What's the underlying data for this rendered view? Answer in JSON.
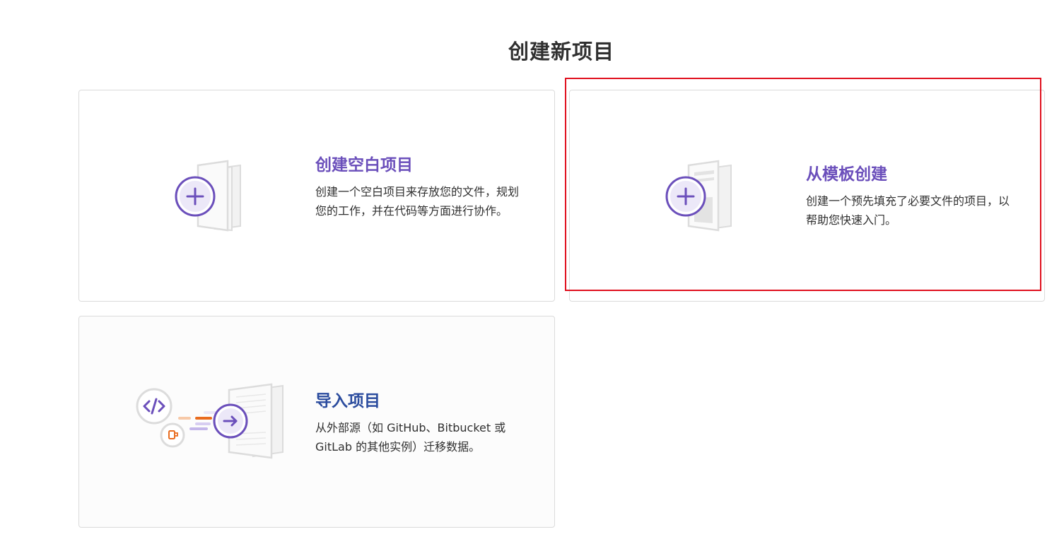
{
  "page": {
    "title": "创建新项目"
  },
  "cards": [
    {
      "id": "blank",
      "title": "创建空白项目",
      "description": "创建一个空白项目来存放您的文件，规划您的工作，并在代码等方面进行协作。",
      "icon": "plus-icon"
    },
    {
      "id": "template",
      "title": "从模板创建",
      "description": "创建一个预先填充了必要文件的项目，以帮助您快速入门。",
      "icon": "plus-icon"
    },
    {
      "id": "import",
      "title": "导入项目",
      "description": "从外部源（如 GitHub、Bitbucket 或 GitLab 的其他实例）迁移数据。",
      "icon": "arrow-right-icon"
    }
  ],
  "colors": {
    "accent": "#6b4fbb",
    "import_title": "#2b4c9e",
    "highlight": "#e0101e",
    "border": "#dbdbdb",
    "orange": "#e96c1f"
  }
}
